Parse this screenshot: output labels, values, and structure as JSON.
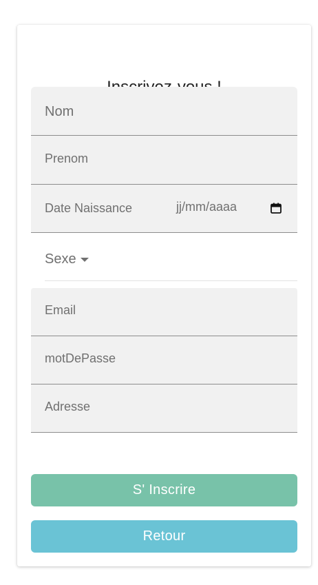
{
  "form": {
    "title": "Inscrivez-vous !",
    "fields": {
      "nom": {
        "placeholder": "Nom"
      },
      "prenom": {
        "placeholder": "Prenom"
      },
      "date_naissance": {
        "label": "Date Naissance",
        "value": "jj/mm/aaaa",
        "icon": "calendar-icon"
      },
      "sexe": {
        "label": "Sexe",
        "icon": "caret-down-icon"
      },
      "email": {
        "placeholder": "Email"
      },
      "mot_de_passe": {
        "placeholder": "motDePasse"
      },
      "adresse": {
        "placeholder": "Adresse"
      }
    },
    "buttons": {
      "inscrire_label": "S' Inscrire",
      "retour_label": "Retour"
    }
  },
  "colors": {
    "field_background": "#f1f1f1",
    "inscrire_button": "#78c2a9",
    "retour_button": "#6ac3d5",
    "text_muted": "#707070",
    "title_text": "#222222"
  }
}
